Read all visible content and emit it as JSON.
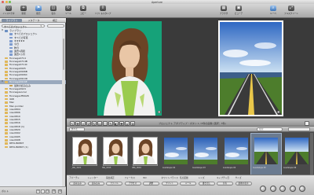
{
  "window": {
    "title": "Aperture"
  },
  "toolbar": {
    "items": [
      {
        "icon": "inspector-icon",
        "label": "インスペクタ"
      },
      {
        "icon": "new-item-icon",
        "label": "新規"
      },
      {
        "icon": "flag-icon",
        "label": "統合"
      },
      {
        "icon": "view-icon",
        "label": "表示"
      },
      {
        "icon": "rotate-icon",
        "label": "ツール"
      },
      {
        "icon": "split-icon",
        "label": "コピー"
      },
      {
        "icon": "lift-icon",
        "label": "リフト＆スタンプ"
      },
      {
        "icon": "browser-icon",
        "label": "ブラウザ"
      },
      {
        "icon": "viewer-icon",
        "label": "ビューア"
      },
      {
        "icon": "loupe-icon",
        "label": "ルーペ"
      },
      {
        "icon": "fullscreen-icon",
        "label": "フルスクリーン"
      }
    ]
  },
  "library": {
    "tabs": [
      "ライブラリ",
      "メタデータ",
      "補正"
    ],
    "active_tab": 0,
    "selector": "すべてのプロジェクト",
    "items": [
      {
        "label": "ライブラリ",
        "color": "#6b8fc2",
        "indent": 0,
        "tri": "▼"
      },
      {
        "label": "すべてのプロジェクト",
        "color": "#7e9ccf",
        "indent": 1
      },
      {
        "label": "すべての写真",
        "color": "#7e9ccf",
        "indent": 1
      },
      {
        "label": "★★★★★",
        "color": "#7e9ccf",
        "indent": 1
      },
      {
        "label": "今日",
        "color": "#7e9ccf",
        "indent": 1
      },
      {
        "label": "昨日",
        "color": "#7e9ccf",
        "indent": 1
      },
      {
        "label": "過去1週間",
        "color": "#7e9ccf",
        "indent": 1
      },
      {
        "label": "過去1ヵ月",
        "color": "#7e9ccf",
        "indent": 1
      },
      {
        "label": "fionnaga0714",
        "color": "#e0b75a",
        "indent": 0
      },
      {
        "label": "fionnaga0714B",
        "color": "#e0b75a",
        "indent": 0
      },
      {
        "label": "fionnaga0714C",
        "color": "#e0b75a",
        "indent": 0
      },
      {
        "label": "fionnaga0905",
        "color": "#e0b75a",
        "indent": 0
      },
      {
        "label": "fionnaga0906B",
        "color": "#e0b75a",
        "indent": 0
      },
      {
        "label": "fionnaga0906C",
        "color": "#e0b75a",
        "indent": 0
      },
      {
        "label": "fionnaga0910D",
        "color": "#e0b75a",
        "indent": 0
      },
      {
        "label": "fionnaga0916E",
        "color": "#e0b75a",
        "indent": 0,
        "tri": "▼",
        "selected": true
      },
      {
        "label": "最新の読み込み",
        "color": "#c9a04e",
        "indent": 1
      },
      {
        "label": "fionnaga0924",
        "color": "#e0b75a",
        "indent": 0
      },
      {
        "label": "fionnagasocial",
        "color": "#e0b75a",
        "indent": 0
      },
      {
        "label": "fionnagaoff0928",
        "color": "#e0b75a",
        "indent": 0
      },
      {
        "label": "libB",
        "color": "#e0b75a",
        "indent": 0
      },
      {
        "label": "Mac",
        "color": "#e0b75a",
        "indent": 0
      },
      {
        "label": "Mac-pointer",
        "color": "#e0b75a",
        "indent": 0
      },
      {
        "label": "nisu0804",
        "color": "#e0b75a",
        "indent": 0
      },
      {
        "label": "nisu0806",
        "color": "#e0b75a",
        "indent": 0
      },
      {
        "label": "nisu0810",
        "color": "#e0b75a",
        "indent": 0
      },
      {
        "label": "nisu0815",
        "color": "#e0b75a",
        "indent": 0
      },
      {
        "label": "nisu0816",
        "color": "#e0b75a",
        "indent": 0
      },
      {
        "label": "nisu0818 (1)",
        "color": "#e0b75a",
        "indent": 0
      },
      {
        "label": "nisu0820",
        "color": "#e0b75a",
        "indent": 0
      },
      {
        "label": "nisu0902",
        "color": "#e0b75a",
        "indent": 0
      },
      {
        "label": "nisu0905",
        "color": "#e0b75a",
        "indent": 0
      },
      {
        "label": "nisu0908",
        "color": "#e0b75a",
        "indent": 0
      },
      {
        "label": "REVLIN0807",
        "color": "#e0b75a",
        "indent": 0
      },
      {
        "label": "REVLIN0807 (1)",
        "color": "#e0b75a",
        "indent": 0
      }
    ],
    "bottom_label": "ボルト",
    "bottom_buttons": [
      "+",
      "-",
      "◷",
      "☰",
      "⚙"
    ]
  },
  "viewer": {
    "badge_left": "■",
    "badge_right": "■"
  },
  "toolstrip": {
    "buttons": [
      "↖",
      "✥",
      "⌕",
      "↺",
      "↻",
      "▭",
      "⬚",
      "✎",
      "◐",
      "✚",
      "⌂",
      "⊕"
    ],
    "center_text": "プロジェクト アダプティブ・ボタン 1 / 8件の画像 (選択：3件)"
  },
  "browser": {
    "filter_label": "すべて",
    "search_placeholder": "検索",
    "thumbs": [
      {
        "label": "_MG_4421",
        "kind": "portrait",
        "selected": false
      },
      {
        "label": "IMG_0015",
        "kind": "portrait",
        "selected": false
      },
      {
        "label": "IMG_0016",
        "kind": "portrait",
        "selected": false
      },
      {
        "label": "Guadalupe 02",
        "kind": "sky",
        "selected": false
      },
      {
        "label": "Guadalupe 03",
        "kind": "sky",
        "selected": false
      },
      {
        "label": "Guadalupe 04",
        "kind": "sky",
        "selected": false
      },
      {
        "label": "Guadalupe 05",
        "kind": "road",
        "selected": true
      },
      {
        "label": "Guadalupe 06",
        "kind": "road",
        "selected": false
      }
    ]
  },
  "metadata": {
    "row1": [
      "アパーチャ",
      "シャッター",
      "露出補正",
      "フォーカス",
      "ISO",
      "ホワイトバランス",
      "焦点距離",
      "レンズ",
      "キャプチャ日",
      "サイズ"
    ],
    "row2_buttons": [
      "読み込み",
      "読み込み",
      "ファイル",
      "アクセス",
      "調整",
      "プリント",
      "メール",
      "書き出し",
      "共有",
      "最後の表示"
    ],
    "circles": 5
  },
  "colors": {
    "selection": "#9aa9bd",
    "folder": "#e0b75a",
    "accent": "#3d74b8"
  }
}
